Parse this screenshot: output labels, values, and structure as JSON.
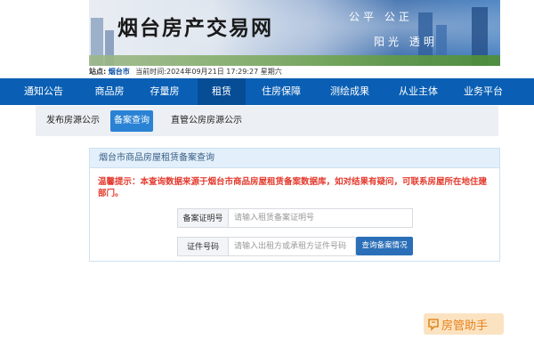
{
  "banner": {
    "title": "烟台房产交易网",
    "slogan_line1": "公平  公正",
    "slogan_line2": "阳光  透明"
  },
  "infobar": {
    "site_label": "站点:",
    "city": "烟台市",
    "time_label": "当前时间:",
    "time_value": "2024年09月21日 17:29:27 星期六"
  },
  "main_nav": {
    "items": [
      "通知公告",
      "商品房",
      "存量房",
      "租赁",
      "住房保障",
      "测绘成果",
      "从业主体",
      "业务平台"
    ],
    "active": "租赁"
  },
  "sub_nav": {
    "items": [
      "发布房源公示",
      "备案查询",
      "直管公房房源公示"
    ],
    "active": "备案查询"
  },
  "panel": {
    "title": "烟台市商品房屋租赁备案查询",
    "notice": "温馨提示：本查询数据来源于烟台市商品房屋租赁备案数据库，如对结果有疑问，可联系房屋所在地住建部门。",
    "field1": {
      "label": "备案证明号",
      "placeholder": "请输入租赁备案证明号",
      "value": ""
    },
    "field2": {
      "label": "证件号码",
      "placeholder": "请输入出租方或承租方证件号码",
      "value": ""
    },
    "query_button": "查询备案情况"
  },
  "helper_badge": {
    "text": "房管助手",
    "icon": "house-chat-icon"
  },
  "colors": {
    "nav_bg": "#0a5fb4",
    "nav_active": "#064d96",
    "notice_red": "#e33b2e",
    "button_blue": "#2a6fb8",
    "panel_header_bg": "#e3f0fb"
  }
}
